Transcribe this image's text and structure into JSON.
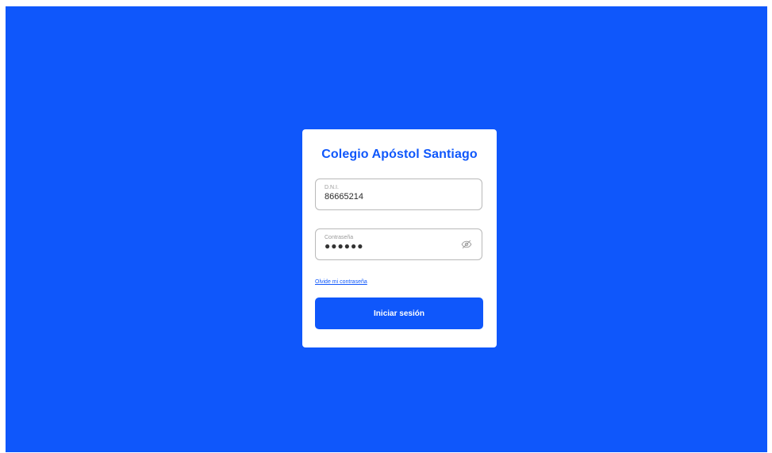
{
  "login": {
    "title": "Colegio Apóstol Santiago",
    "dni_label": "D.N.I.",
    "dni_value": "86665214",
    "password_label": "Contraseña",
    "password_mask": "●●●●●●",
    "toggle_icon": "eye-off-icon",
    "forgot_link": "Olvide mi contraseña",
    "submit_label": "Iniciar sesión"
  },
  "colors": {
    "background": "#0f57fb",
    "card": "#ffffff",
    "accent": "#0f57fb"
  }
}
